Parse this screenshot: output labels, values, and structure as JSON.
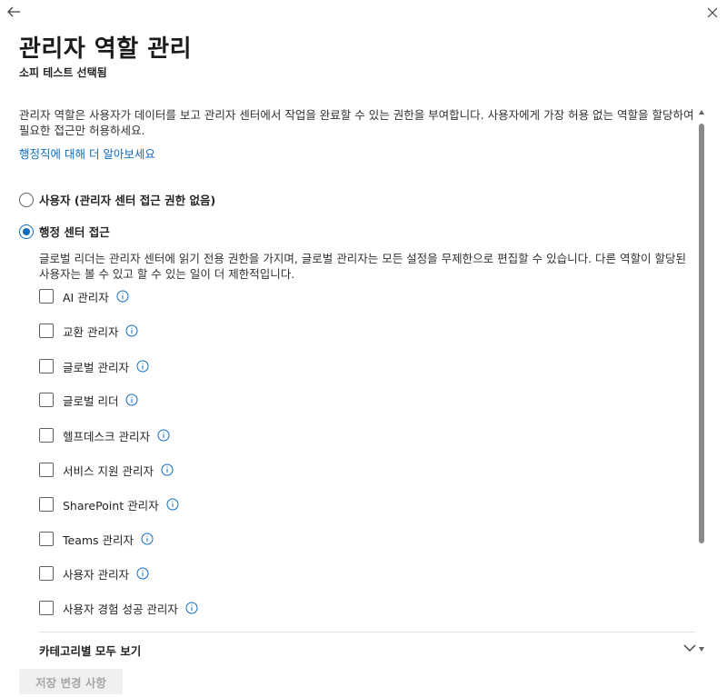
{
  "header": {
    "title": "관리자 역할 관리",
    "subtitle": "소피 테스트 선택됨"
  },
  "intro": {
    "description": "관리자 역할은 사용자가 데이터를 보고 관리자 센터에서 작업을 완료할 수 있는 권한을 부여합니다. 사용자에게 가장 허용 없는 역할을 할당하여 필요한 접근만 허용하세요.",
    "link": "행정직에 대해 더 알아보세요"
  },
  "access_options": [
    {
      "label": "사용자 (관리자 센터 접근 권한 없음)",
      "selected": false
    },
    {
      "label": "행정 센터 접근",
      "selected": true
    }
  ],
  "admin_description": "글로벌 리더는 관리자 센터에 읽기 전용 권한을 가지며, 글로벌 관리자는 모든 설정을 무제한으로 편집할 수 있습니다. 다른 역할이 할당된 사용자는 볼 수 있고 할 수 있는 일이 더 제한적입니다.",
  "roles": [
    {
      "label": "AI 관리자",
      "checked": false
    },
    {
      "label": "교환 관리자",
      "checked": false
    },
    {
      "label": "글로벌 관리자",
      "checked": false
    },
    {
      "label": "글로벌 리더",
      "checked": false
    },
    {
      "label": "헬프데스크 관리자",
      "checked": false
    },
    {
      "label": "서비스 지원 관리자",
      "checked": false
    },
    {
      "label": "SharePoint 관리자",
      "checked": false
    },
    {
      "label": "Teams 관리자",
      "checked": false
    },
    {
      "label": "사용자 관리자",
      "checked": false
    },
    {
      "label": "사용자 경험 성공 관리자",
      "checked": false
    }
  ],
  "view_all": "카테고리별 모두 보기",
  "save_button": "저장 변경 사항",
  "colors": {
    "accent": "#0f6cbd",
    "disabled_bg": "#f0f0f0",
    "disabled_text": "#a6a6a6"
  },
  "icons": {
    "back": "arrow-left-icon",
    "close": "close-icon",
    "info": "info-icon",
    "expand": "chevron-down-icon"
  }
}
